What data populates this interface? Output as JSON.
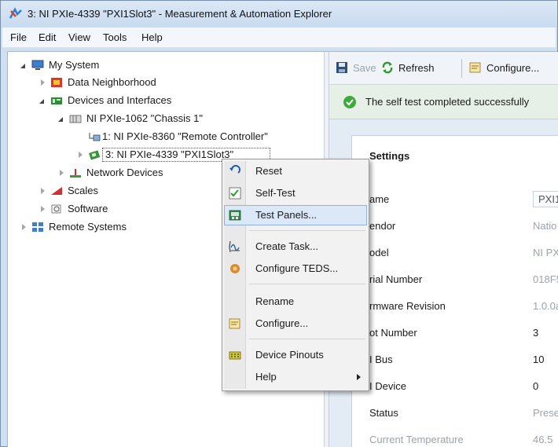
{
  "window": {
    "title": "3: NI PXIe-4339 \"PXI1Slot3\" - Measurement & Automation Explorer"
  },
  "menubar": [
    "File",
    "Edit",
    "View",
    "Tools",
    "Help"
  ],
  "tree": {
    "items": [
      {
        "label": "My System",
        "icon": "computer-icon"
      },
      {
        "label": "Data Neighborhood",
        "icon": "data-neighborhood-icon"
      },
      {
        "label": "Devices and Interfaces",
        "icon": "devices-icon"
      },
      {
        "label": "NI PXIe-1062 \"Chassis 1\"",
        "icon": "chassis-icon"
      },
      {
        "label": "1: NI PXIe-8360 \"Remote Controller\"",
        "icon": "controller-icon"
      },
      {
        "label": "3: NI PXIe-4339 \"PXI1Slot3\"",
        "icon": "device-icon"
      },
      {
        "label": "Network Devices",
        "icon": "network-icon"
      },
      {
        "label": "Scales",
        "icon": "scales-icon"
      },
      {
        "label": "Software",
        "icon": "software-icon"
      },
      {
        "label": "Remote Systems",
        "icon": "remote-systems-icon"
      }
    ]
  },
  "toolbar": {
    "save_label": "Save",
    "refresh_label": "Refresh",
    "configure_label": "Configure..."
  },
  "status": {
    "text": "The self test completed successfully"
  },
  "settings": {
    "title": "Settings",
    "rows": [
      {
        "label": "ame",
        "value": "PXI1S"
      },
      {
        "label": "endor",
        "value": "Natio"
      },
      {
        "label": "odel",
        "value": "NI PX"
      },
      {
        "label": "rial Number",
        "value": "018F5"
      },
      {
        "label": "rmware Revision",
        "value": "1.0.0a"
      },
      {
        "label": "ot Number",
        "value": "3"
      },
      {
        "label": "I Bus",
        "value": "10"
      },
      {
        "label": "I Device",
        "value": "0"
      },
      {
        "label": "Status",
        "value": "Prese"
      },
      {
        "label": "Current Temperature",
        "value": "46.5"
      }
    ]
  },
  "context_menu": {
    "items": [
      {
        "label": "Reset",
        "icon": "reset-icon"
      },
      {
        "label": "Self-Test",
        "icon": "self-test-icon"
      },
      {
        "label": "Test Panels...",
        "icon": "test-panels-icon"
      },
      {
        "label": "Create Task...",
        "icon": "create-task-icon"
      },
      {
        "label": "Configure TEDS...",
        "icon": "configure-teds-icon"
      },
      {
        "label": "Rename",
        "icon": ""
      },
      {
        "label": "Configure...",
        "icon": "configure-icon"
      },
      {
        "label": "Device Pinouts",
        "icon": "device-pinouts-icon"
      },
      {
        "label": "Help",
        "icon": ""
      }
    ],
    "highlighted": "Test Panels..."
  },
  "colors": {
    "accent": "#3399ff",
    "success": "#3fa93f",
    "menu_highlight": "#dbe8f8"
  }
}
